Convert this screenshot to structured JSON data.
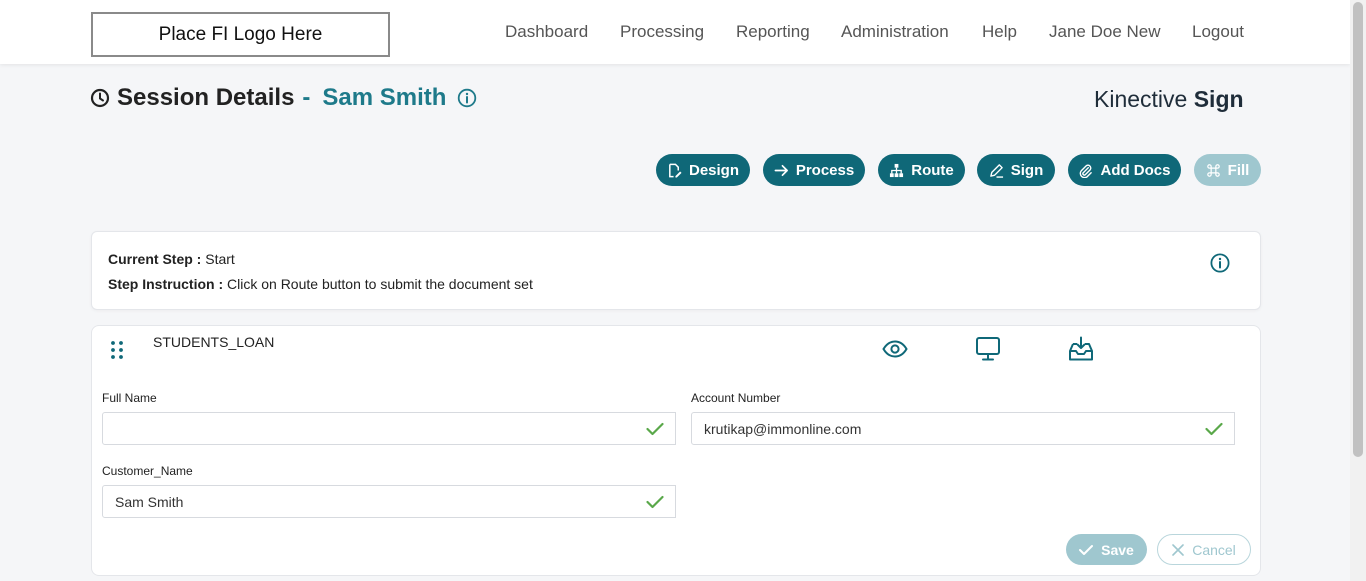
{
  "header": {
    "logo_text": "Place FI Logo Here",
    "nav": [
      "Dashboard",
      "Processing",
      "Reporting",
      "Administration",
      "Help",
      "Jane Doe New",
      "Logout"
    ]
  },
  "page": {
    "title": "Session Details",
    "title_separator": "-",
    "signer_name": "Sam Smith",
    "brand_light": "Kinective",
    "brand_bold": "Sign"
  },
  "actions": {
    "design": "Design",
    "process": "Process",
    "route": "Route",
    "sign": "Sign",
    "add_docs": "Add Docs",
    "fill": "Fill"
  },
  "step": {
    "current_label": "Current Step :",
    "current_value": "Start",
    "instruction_label": "Step Instruction :",
    "instruction_value": "Click on Route button to submit the document set"
  },
  "document": {
    "name": "STUDENTS_LOAN",
    "icons": [
      "eye-icon",
      "monitor-icon",
      "inbox-download-icon"
    ],
    "fields": {
      "full_name": {
        "label": "Full Name",
        "value": ""
      },
      "account_number": {
        "label": "Account Number",
        "value": "krutikap@immonline.com"
      },
      "customer_name": {
        "label": "Customer_Name",
        "value": "Sam Smith"
      }
    },
    "save_label": "Save",
    "cancel_label": "Cancel"
  },
  "colors": {
    "accent": "#0f6878",
    "accent_disabled": "#9fc7cf",
    "check": "#5aa84a",
    "background": "#f5f6f8"
  }
}
